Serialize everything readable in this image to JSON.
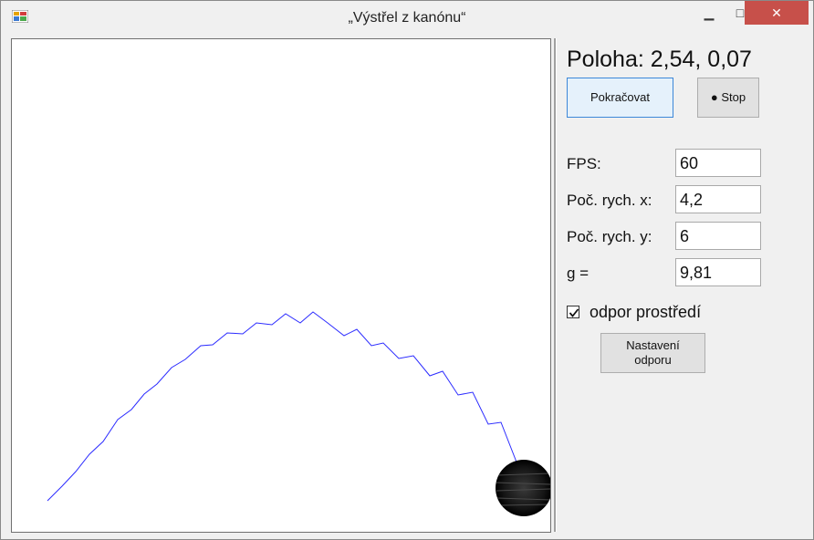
{
  "window": {
    "title": "„Výstřel z kanónu“",
    "minimize_glyph": "▁",
    "maximize_glyph": "□",
    "close_glyph": "✕"
  },
  "panel": {
    "status_label": "Poloha: 2,54, 0,07",
    "continue_button": "Pokračovat",
    "stop_button": "● Stop",
    "fields": [
      {
        "label": "FPS:",
        "value": "60"
      },
      {
        "label": "Poč. rych. x:",
        "value": "4,2"
      },
      {
        "label": "Poč. rych. y:",
        "value": "6"
      },
      {
        "label": "g =",
        "value": "9,81"
      }
    ],
    "resistance_checkbox": {
      "label": "odpor prostředí",
      "checked": true
    },
    "resistance_settings_button": "Nastavení odporu"
  },
  "colors": {
    "trajectory": "#2b2bff",
    "ball": "#111111",
    "close_button": "#c7504a"
  }
}
